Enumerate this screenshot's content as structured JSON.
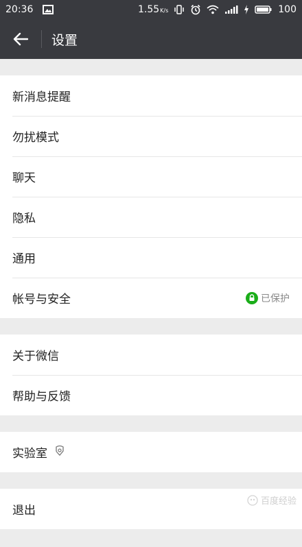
{
  "status": {
    "time": "20:36",
    "speed": "1.55",
    "speed_unit": "K/s",
    "battery": "100"
  },
  "appbar": {
    "title": "设置"
  },
  "groups": [
    {
      "items": [
        {
          "label": "新消息提醒"
        },
        {
          "label": "勿扰模式"
        },
        {
          "label": "聊天"
        },
        {
          "label": "隐私"
        },
        {
          "label": "通用"
        },
        {
          "label": "帐号与安全",
          "status": "已保护"
        }
      ]
    },
    {
      "items": [
        {
          "label": "关于微信"
        },
        {
          "label": "帮助与反馈"
        }
      ]
    },
    {
      "items": [
        {
          "label": "实验室"
        }
      ]
    },
    {
      "items": [
        {
          "label": "退出"
        }
      ]
    }
  ],
  "watermark": "百度经验",
  "colors": {
    "bar": "#393a3f",
    "background": "#ececec",
    "protect_green": "#1aad19"
  }
}
